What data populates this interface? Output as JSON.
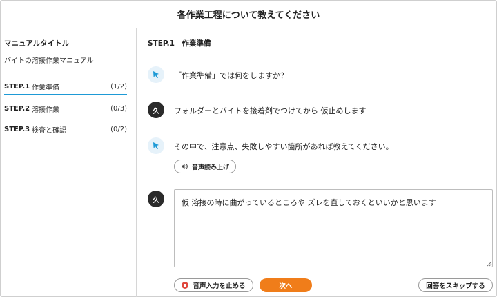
{
  "header": {
    "title": "各作業工程について教えてください"
  },
  "sidebar": {
    "manual_title_label": "マニュアルタイトル",
    "manual_title_value": "バイトの溶接作業マニュアル",
    "steps": [
      {
        "num": "STEP.1",
        "name": "作業準備",
        "count": "(1/2)"
      },
      {
        "num": "STEP.2",
        "name": "溶接作業",
        "count": "(0/3)"
      },
      {
        "num": "STEP.3",
        "name": "検査と確認",
        "count": "(0/2)"
      }
    ]
  },
  "main": {
    "step_header": "STEP.1　作業準備",
    "messages": [
      {
        "from": "bot",
        "text": "「作業準備」では何をしますか？"
      },
      {
        "from": "user",
        "avatar": "久",
        "text": "フォルダーとバイトを接着剤でつけてから 仮止めします"
      },
      {
        "from": "bot",
        "text": "その中で、注意点、失敗しやすい箇所があれば教えてください。"
      }
    ],
    "tts_button": "音声読み上げ",
    "answer_avatar": "久",
    "answer_value": "仮 溶接の時に曲がっているところや ズレを直しておくといいかと思います",
    "buttons": {
      "stop_voice": "音声入力を止める",
      "next": "次へ",
      "skip": "回答をスキップする"
    }
  },
  "colors": {
    "accent": "#1e9ad6",
    "next_button": "#f07d1a",
    "stop_icon": "#e0483e",
    "user_avatar": "#2b2b2b"
  },
  "icons": {
    "bot": "cursor-arrow-icon",
    "tts": "speaker-icon",
    "stop": "stop-record-icon",
    "resize": "resize-grip-icon"
  }
}
